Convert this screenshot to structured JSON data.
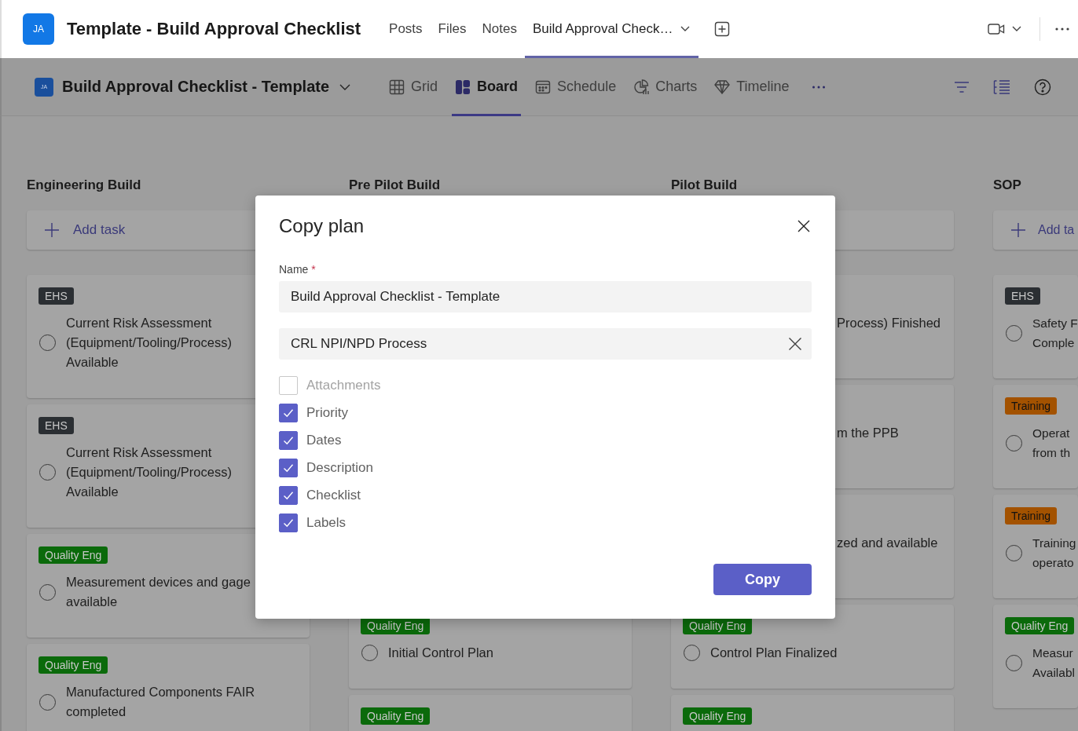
{
  "header": {
    "avatar": "JA",
    "title": "Template - Build Approval Checklist",
    "tabs": [
      {
        "label": "Posts",
        "selected": false,
        "has_menu": false
      },
      {
        "label": "Files",
        "selected": false,
        "has_menu": false
      },
      {
        "label": "Notes",
        "selected": false,
        "has_menu": false
      },
      {
        "label": "Build Approval Check…",
        "selected": true,
        "has_menu": true
      }
    ]
  },
  "plan_bar": {
    "avatar": "JA",
    "title": "Build Approval Checklist - Template",
    "views": [
      {
        "label": "Grid",
        "kind": "grid",
        "selected": false
      },
      {
        "label": "Board",
        "kind": "board",
        "selected": true
      },
      {
        "label": "Schedule",
        "kind": "schedule",
        "selected": false
      },
      {
        "label": "Charts",
        "kind": "charts",
        "selected": false
      },
      {
        "label": "Timeline",
        "kind": "timeline",
        "selected": false
      }
    ]
  },
  "board": {
    "columns": [
      {
        "title": "Engineering Build",
        "add_task": true,
        "add_task_label": "Add task",
        "tasks": [
          {
            "kind": "card",
            "tag": "EHS",
            "color": "#2b2f33",
            "lines": [
              "Current Risk Assessment",
              "(Equipment/Tooling/Process)",
              "Available"
            ]
          },
          {
            "kind": "card",
            "tag": "EHS",
            "color": "#2b2f33",
            "lines": [
              "Current Risk Assessment",
              "(Equipment/Tooling/Process)",
              "Available"
            ]
          },
          {
            "kind": "card",
            "tag": "Quality Eng",
            "color": "#0b6a0b",
            "lines": [
              "Measurement devices and gage",
              "available"
            ]
          },
          {
            "kind": "card",
            "tag": "Quality Eng",
            "color": "#0b6a0b",
            "lines": [
              "Manufactured Components FAIR",
              "completed"
            ]
          }
        ]
      },
      {
        "title": "Pre Pilot Build",
        "add_task": false,
        "tasks": [
          {
            "kind": "card",
            "tag": "Quality Eng",
            "color": "#0b6a0b",
            "lines": [
              "Initial Control Plan"
            ]
          },
          {
            "kind": "card",
            "tag": "Quality Eng",
            "color": "#0b6a0b"
          }
        ]
      },
      {
        "title": "Pilot Build",
        "add_task": true,
        "tasks": [
          {
            "kind": "covered",
            "lines": [
              "Process) Finished"
            ]
          },
          {
            "kind": "covered",
            "lines": [
              "m the PPB"
            ]
          },
          {
            "kind": "covered",
            "lines": [
              "zed and available"
            ]
          },
          {
            "kind": "card",
            "tag": "Quality Eng",
            "color": "#0b6a0b",
            "lines": [
              "Control Plan Finalized"
            ]
          },
          {
            "kind": "card",
            "tag": "Quality Eng",
            "color": "#0b6a0b"
          }
        ]
      },
      {
        "title": "SOP",
        "add_task": true,
        "add_task_label": "Add ta",
        "tasks": [
          {
            "kind": "card",
            "tag": "EHS",
            "color": "#2b2f33",
            "lines": [
              "Safety F",
              "Comple"
            ]
          },
          {
            "kind": "card",
            "tag": "Training",
            "color": "#a35200",
            "lines": [
              "Operat",
              "from th"
            ]
          },
          {
            "kind": "card",
            "tag": "Training",
            "color": "#a35200",
            "lines": [
              "Training",
              "operato"
            ]
          },
          {
            "kind": "card",
            "tag": "Quality Eng",
            "color": "#0b6a0b",
            "lines": [
              "Measur",
              "Availabl"
            ]
          }
        ]
      }
    ]
  },
  "dialog": {
    "title": "Copy plan",
    "name_label": "Name",
    "required_mark": "*",
    "name_value": "Build Approval Checklist - Template",
    "group_value": "CRL NPI/NPD Process",
    "options": [
      {
        "label": "Attachments",
        "checked": false,
        "disabled": true
      },
      {
        "label": "Priority",
        "checked": true,
        "disabled": false
      },
      {
        "label": "Dates",
        "checked": true,
        "disabled": false
      },
      {
        "label": "Description",
        "checked": true,
        "disabled": false
      },
      {
        "label": "Checklist",
        "checked": true,
        "disabled": false
      },
      {
        "label": "Labels",
        "checked": true,
        "disabled": false
      }
    ],
    "copy_button": "Copy"
  }
}
